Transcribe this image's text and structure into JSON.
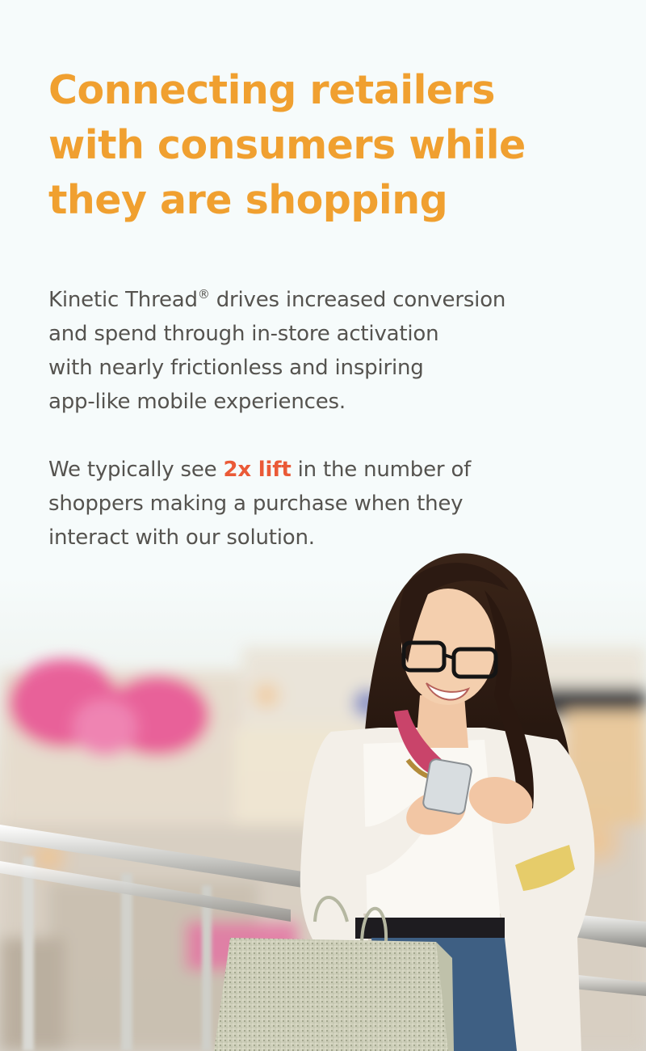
{
  "headline": {
    "lines": [
      "Connecting retailers",
      "with consumers while",
      "they are shopping"
    ]
  },
  "intro": {
    "brand": "Kinetic Thread",
    "registered_mark": "®",
    "line1_rest": " drives increased conversion",
    "line2": "and spend through in-store activation",
    "line3": "with nearly frictionless and inspiring",
    "line4": "app-like mobile experiences."
  },
  "stat": {
    "line1_before": "We typically see ",
    "highlight": "2x lift",
    "line1_after": " in the number of",
    "line2": "shoppers making a purchase when they",
    "line3": "interact with our solution."
  },
  "colors": {
    "headline": "#f0a030",
    "body_text": "#55534f",
    "highlight": "#ea5a37",
    "background": "#f6fbfb"
  }
}
